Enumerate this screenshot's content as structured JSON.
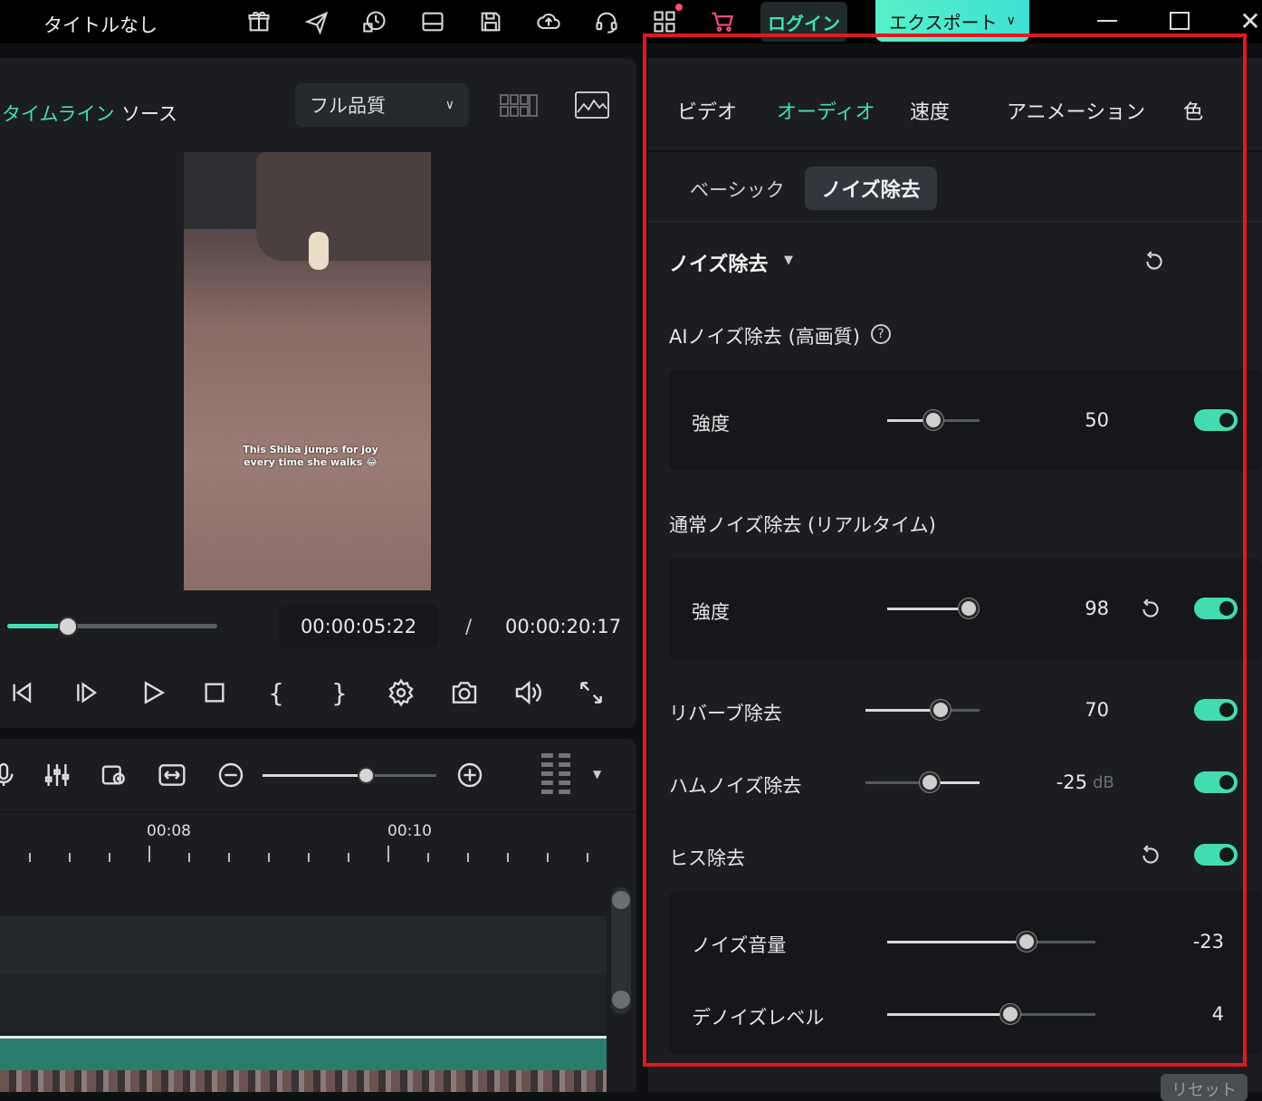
{
  "app": {
    "title": "タイトルなし",
    "login": "ログイン",
    "export": "エクスポート"
  },
  "colors": {
    "accent": "#43dcb0",
    "highlight_box": "#e0191f"
  },
  "player": {
    "tab_timeline": "タイムライン",
    "tab_source": "ソース",
    "quality": "フル品質",
    "current_time": "00:00:05:22",
    "separator": "/",
    "total_time": "00:00:20:17",
    "progress": 0.29,
    "caption_line1": "This Shiba jumps for joy",
    "caption_line2": "every time she walks 😂"
  },
  "timeline": {
    "ruler_labels": [
      "00:08",
      "00:10"
    ],
    "zoom": 0.6
  },
  "panel": {
    "tabs": [
      "ビデオ",
      "オーディオ",
      "速度",
      "アニメーション",
      "色"
    ],
    "active_tab": "オーディオ",
    "subtabs": {
      "basic": "ベーシック",
      "noise": "ノイズ除去"
    },
    "section_title": "ノイズ除去",
    "ai_heading": "AIノイズ除去 (高画質)",
    "ai_strength": {
      "label": "強度",
      "value": "50",
      "fraction": 0.5
    },
    "normal_heading": "通常ノイズ除去 (リアルタイム)",
    "normal_strength": {
      "label": "強度",
      "value": "98",
      "fraction": 0.88
    },
    "reverb": {
      "label": "リバーブ除去",
      "value": "70",
      "fraction": 0.66
    },
    "hum": {
      "label": "ハムノイズ除去",
      "value": "-25",
      "unit": "dB",
      "fraction": 0.56
    },
    "hiss": {
      "label": "ヒス除去"
    },
    "noise_volume": {
      "label": "ノイズ音量",
      "value": "-23",
      "fraction": 0.67
    },
    "denoise_level": {
      "label": "デノイズレベル",
      "value": "4",
      "fraction": 0.59
    },
    "reset_button": "リセット"
  }
}
